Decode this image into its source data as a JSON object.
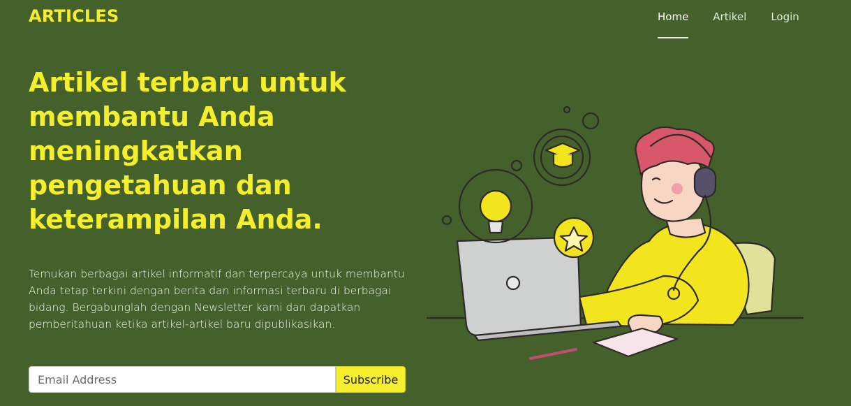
{
  "header": {
    "brand": "ARTICLES",
    "nav": [
      {
        "label": "Home",
        "active": true
      },
      {
        "label": "Artikel",
        "active": false
      },
      {
        "label": "Login",
        "active": false
      }
    ]
  },
  "hero": {
    "title": "Artikel terbaru untuk membantu Anda meningkatkan pengetahuan dan keterampilan Anda.",
    "description": "Temukan berbagai artikel informatif dan terpercaya untuk membantu Anda tetap terkini dengan berita dan informasi terbaru di berbagai bidang. Bergabunglah dengan Newsletter kami dan dapatkan pemberitahuan ketika artikel-artikel baru dipublikasikan.",
    "email_placeholder": "Email Address",
    "subscribe_label": "Subscribe"
  },
  "colors": {
    "background": "#45612b",
    "accent": "#f5ee2c"
  }
}
